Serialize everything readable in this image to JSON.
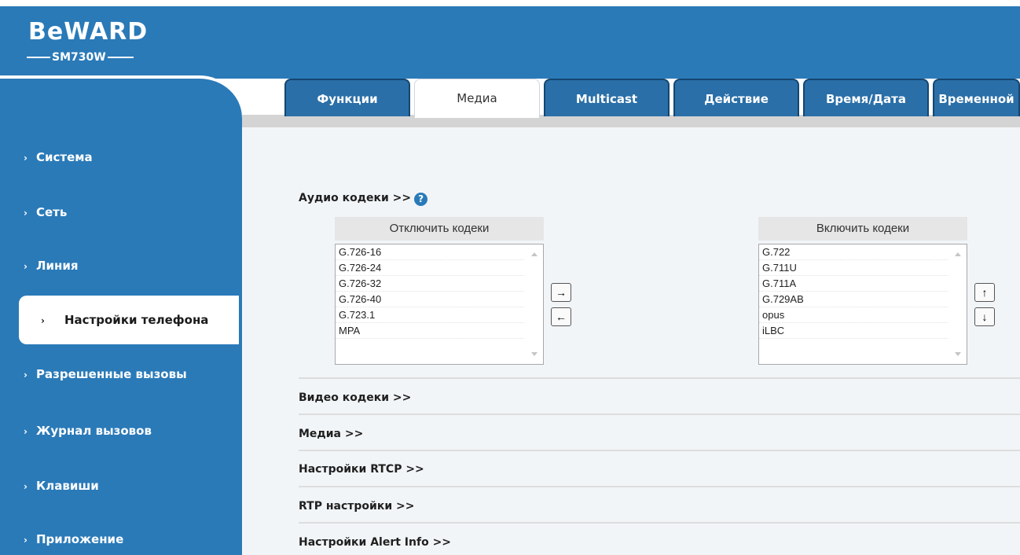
{
  "logo": {
    "brand": "BeWARD",
    "model": "SM730W"
  },
  "sidebar": {
    "items": [
      {
        "label": "Система"
      },
      {
        "label": "Сеть"
      },
      {
        "label": "Линия"
      },
      {
        "label": "Настройки телефона",
        "active": true
      },
      {
        "label": "Разрешенные вызовы"
      },
      {
        "label": "Журнал вызовов"
      },
      {
        "label": "Клавиши"
      },
      {
        "label": "Приложение"
      }
    ]
  },
  "tabs": [
    {
      "label": "Функции"
    },
    {
      "label": "Медиа",
      "active": true
    },
    {
      "label": "Multicast"
    },
    {
      "label": "Действие"
    },
    {
      "label": "Время/Дата"
    },
    {
      "label": "Временной"
    }
  ],
  "audio": {
    "title": "Аудио кодеки >>",
    "disabled_header": "Отключить кодеки",
    "enabled_header": "Включить кодеки",
    "disabled": [
      "G.726-16",
      "G.726-24",
      "G.726-32",
      "G.726-40",
      "G.723.1",
      "MPA"
    ],
    "enabled": [
      "G.722",
      "G.711U",
      "G.711A",
      "G.729AB",
      "opus",
      "iLBC"
    ],
    "move_right": "→",
    "move_left": "←",
    "move_up": "↑",
    "move_down": "↓"
  },
  "sections": [
    "Видео кодеки >>",
    "Медиа >>",
    "Настройки RTCP >>",
    "RTP настройки >>",
    "Настройки Alert Info >>"
  ],
  "colors": {
    "brand_blue": "#2a7ab8",
    "tab_blue": "#2a6fa8",
    "content_bg": "#f2f5f8"
  }
}
